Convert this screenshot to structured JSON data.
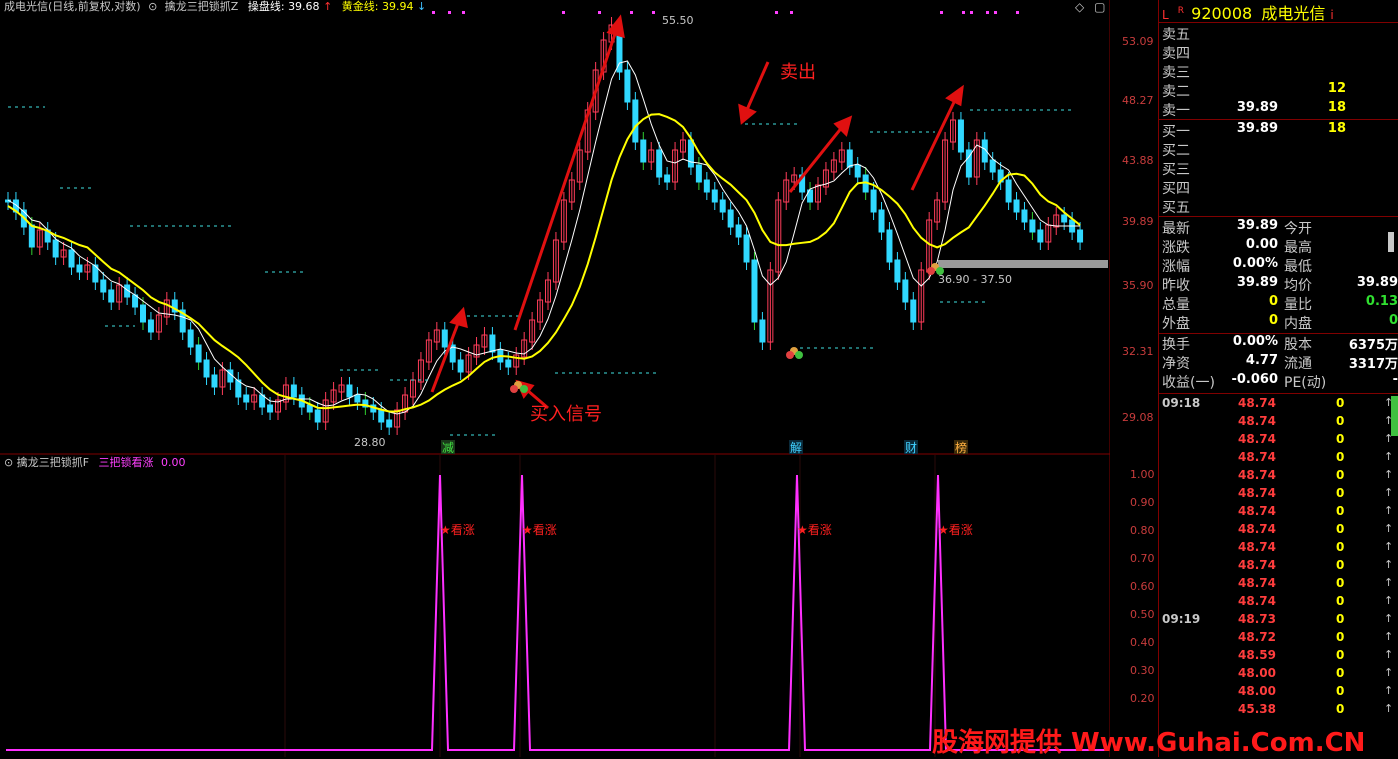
{
  "header": {
    "main_title": "成电光信(日线,前复权,对数)",
    "indicator_name": "擒龙三把锁抓Z",
    "line1_label": "操盘线:",
    "line1_value": "39.68",
    "line2_label": "黄金线:",
    "line2_value": "39.94"
  },
  "main_axis": [
    "53.09",
    "48.27",
    "43.88",
    "39.89",
    "35.90",
    "32.31",
    "29.08"
  ],
  "annotations": {
    "sell": "卖出",
    "buy": "买入信号",
    "high_label": "55.50",
    "low_label": "28.80",
    "range_label": "36.90 - 37.50",
    "tags": [
      "减",
      "解",
      "财",
      "榜"
    ]
  },
  "indicator": {
    "title": "擒龙三把锁抓F",
    "series_name": "三把锁看涨",
    "value": "0.00",
    "signal_label": "★看涨",
    "axis": [
      "1.00",
      "0.90",
      "0.80",
      "0.70",
      "0.60",
      "0.50",
      "0.40",
      "0.30",
      "0.20"
    ]
  },
  "quote": {
    "market": "L",
    "flag": "R",
    "code": "920008",
    "name": "成电光信",
    "asks": [
      {
        "label": "卖五",
        "price": "",
        "vol": ""
      },
      {
        "label": "卖四",
        "price": "",
        "vol": ""
      },
      {
        "label": "卖三",
        "price": "",
        "vol": ""
      },
      {
        "label": "卖二",
        "price": "",
        "vol": "12"
      },
      {
        "label": "卖一",
        "price": "39.89",
        "vol": "18"
      }
    ],
    "bids": [
      {
        "label": "买一",
        "price": "39.89",
        "vol": "18"
      },
      {
        "label": "买二",
        "price": "",
        "vol": ""
      },
      {
        "label": "买三",
        "price": "",
        "vol": ""
      },
      {
        "label": "买四",
        "price": "",
        "vol": ""
      },
      {
        "label": "买五",
        "price": "",
        "vol": ""
      }
    ],
    "stats": [
      {
        "l1": "最新",
        "v1": "39.89",
        "l2": "今开",
        "v2": ""
      },
      {
        "l1": "涨跌",
        "v1": "0.00",
        "l2": "最高",
        "v2": ""
      },
      {
        "l1": "涨幅",
        "v1": "0.00%",
        "l2": "最低",
        "v2": ""
      },
      {
        "l1": "昨收",
        "v1": "39.89",
        "l2": "均价",
        "v2": "39.89"
      },
      {
        "l1": "总量",
        "v1": "0",
        "l2": "量比",
        "v2": "0.13"
      },
      {
        "l1": "外盘",
        "v1": "0",
        "l2": "内盘",
        "v2": "0"
      }
    ],
    "stats2": [
      {
        "l1": "换手",
        "v1": "0.00%",
        "l2": "股本",
        "v2": "6375万"
      },
      {
        "l1": "净资",
        "v1": "4.77",
        "l2": "流通",
        "v2": "3317万"
      },
      {
        "l1": "收益(一)",
        "v1": "-0.060",
        "l2": "PE(动)",
        "v2": "-"
      }
    ],
    "ticks1_time": "09:18",
    "ticks1": [
      "48.74",
      "48.74",
      "48.74",
      "48.74",
      "48.74",
      "48.74",
      "48.74",
      "48.74",
      "48.74",
      "48.74",
      "48.74",
      "48.74"
    ],
    "ticks2_time": "09:19",
    "ticks2": [
      "48.73",
      "48.72",
      "48.59",
      "48.00",
      "48.00",
      "45.38"
    ]
  },
  "watermark": "股海网提供 Www.Guhai.Com.CN",
  "chart_data": [
    {
      "type": "line",
      "title": "擒龙三把锁抓F",
      "series": [
        {
          "name": "三把锁看涨",
          "values": [
            0,
            0,
            0,
            0,
            0,
            0,
            0,
            0,
            0,
            0,
            0,
            0,
            0,
            0,
            0,
            0,
            0,
            0,
            0,
            0,
            0,
            0,
            0,
            0,
            0,
            0,
            0,
            0,
            0,
            0,
            0,
            0,
            0,
            0,
            0,
            0,
            0,
            0,
            0,
            0,
            0,
            0,
            0,
            0,
            0,
            0,
            0,
            0,
            0,
            0,
            0,
            0,
            0,
            0,
            0,
            0,
            0,
            0,
            0,
            0,
            0,
            0,
            0,
            0,
            0,
            0,
            0,
            0,
            0,
            0,
            0,
            0,
            0,
            0,
            0,
            0,
            0,
            0,
            0,
            0,
            0,
            0,
            0,
            0,
            0,
            0,
            0,
            0,
            0,
            0,
            0,
            0,
            0,
            0,
            0,
            0,
            0,
            0,
            0,
            0,
            0,
            0,
            0,
            0,
            0,
            0,
            0,
            0,
            0,
            0,
            0,
            0,
            0,
            0,
            0,
            0,
            0,
            0,
            0,
            0,
            0,
            0,
            0,
            0,
            0,
            0,
            0,
            0,
            0,
            0,
            0,
            0,
            0,
            0,
            0,
            0,
            0,
            0,
            0,
            0,
            0,
            0,
            0,
            0,
            0,
            0,
            0,
            0,
            0,
            0,
            0,
            0,
            0,
            0,
            0,
            0,
            0,
            0,
            0,
            0,
            0,
            0,
            0,
            0,
            0,
            0,
            0,
            0,
            0,
            0
          ]
        }
      ],
      "spikes": [
        62,
        74,
        113,
        133
      ],
      "ylim": [
        0,
        1
      ]
    }
  ]
}
